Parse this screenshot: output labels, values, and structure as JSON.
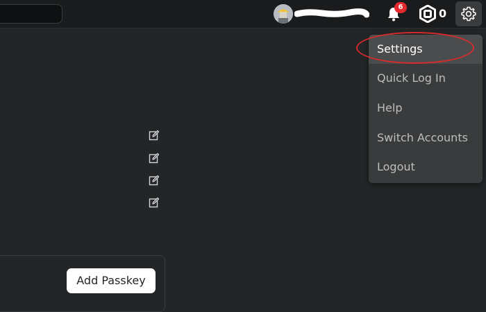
{
  "header": {
    "notification_count": "6",
    "robux_count": "0"
  },
  "dropdown": {
    "items": [
      {
        "label": "Settings"
      },
      {
        "label": "Quick Log In"
      },
      {
        "label": "Help"
      },
      {
        "label": "Switch Accounts"
      },
      {
        "label": "Logout"
      }
    ]
  },
  "passkey": {
    "add_label": "Add Passkey"
  },
  "colors": {
    "background": "#232527",
    "topbar": "#191b1d",
    "dropdown": "#393b3d",
    "badge": "#e3292e",
    "highlight_ring": "#d92b2b"
  },
  "icons": [
    "search-box",
    "avatar",
    "bell-icon",
    "robux-icon",
    "gear-icon",
    "edit-icon"
  ]
}
